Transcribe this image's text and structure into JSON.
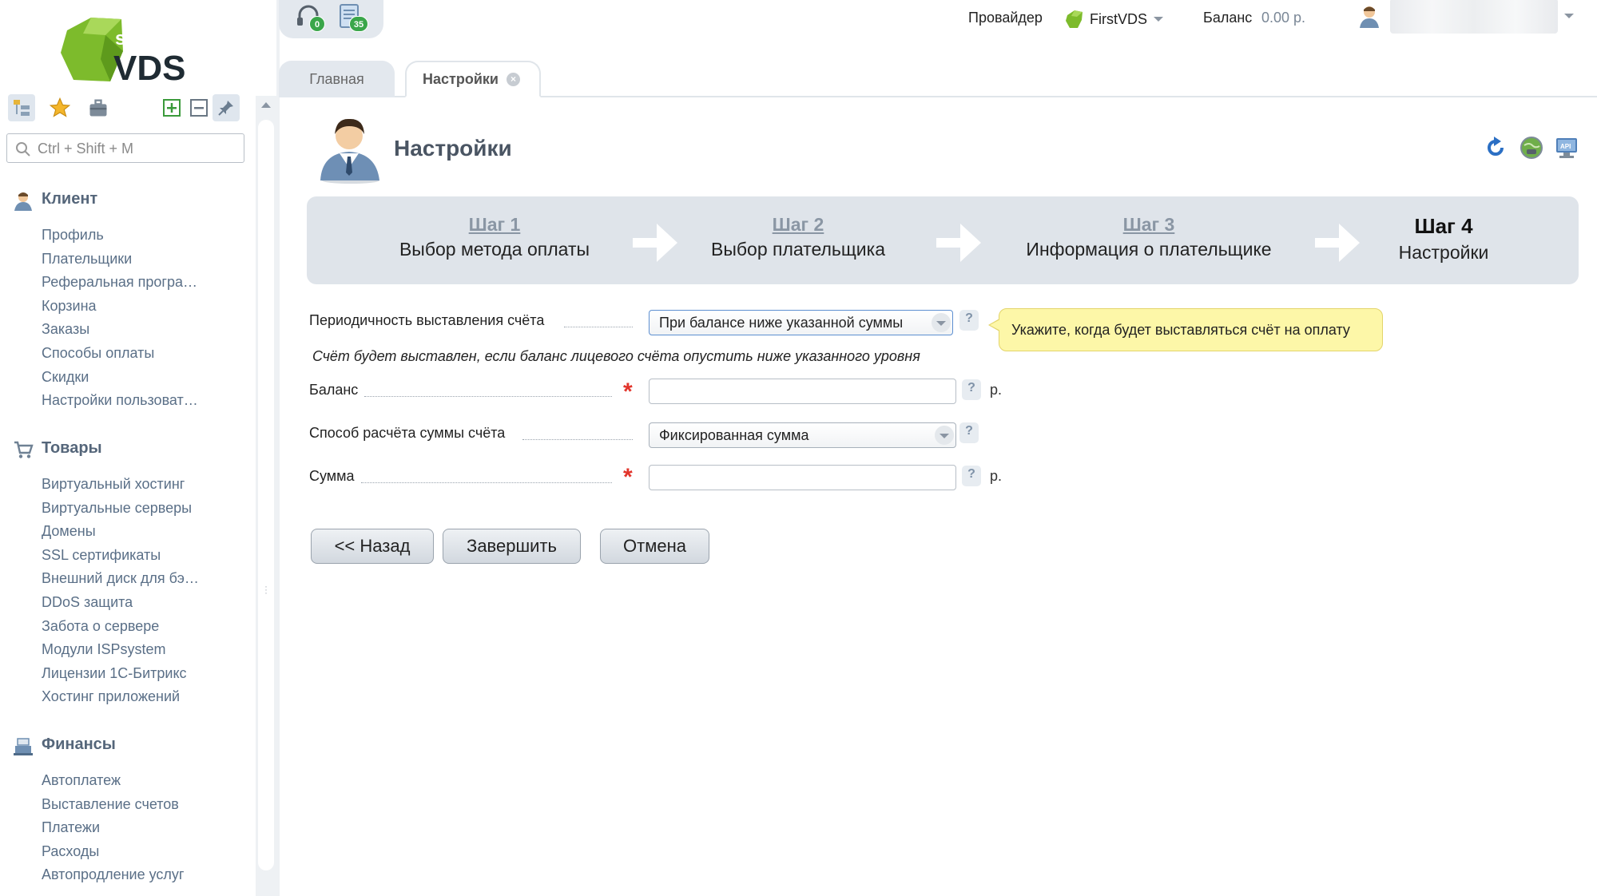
{
  "app": {
    "logo_text": "VDS",
    "logo_superscript": "st"
  },
  "sidebar": {
    "search_placeholder": "Ctrl + Shift + M",
    "groups": [
      {
        "title": "Клиент",
        "icon": "user-icon",
        "items": [
          "Профиль",
          "Плательщики",
          "Реферальная програ…",
          "Корзина",
          "Заказы",
          "Способы оплаты",
          "Скидки",
          "Настройки пользоват…"
        ]
      },
      {
        "title": "Товары",
        "icon": "cart-icon",
        "items": [
          "Виртуальный хостинг",
          "Виртуальные серверы",
          "Домены",
          "SSL сертификаты",
          "Внешний диск для бэ…",
          "DDoS защита",
          "Забота о сервере",
          "Модули ISPsystem",
          "Лицензии 1С-Битрикс",
          "Хостинг приложений"
        ]
      },
      {
        "title": "Финансы",
        "icon": "cash-register-icon",
        "items": [
          "Автоплатеж",
          "Выставление счетов",
          "Платежи",
          "Расходы",
          "Автопродление услуг"
        ]
      }
    ]
  },
  "top": {
    "support_badge": "0",
    "notifications_badge": "35",
    "provider_label": "Провайдер",
    "provider_name": "FirstVDS",
    "balance_label": "Баланс",
    "balance_value": "0.00 р."
  },
  "tabs": [
    {
      "label": "Главная",
      "active": false
    },
    {
      "label": "Настройки",
      "active": true
    }
  ],
  "page": {
    "title": "Настройки"
  },
  "steps": [
    {
      "number": "Шаг 1",
      "label": "Выбор метода оплаты"
    },
    {
      "number": "Шаг 2",
      "label": "Выбор плательщика"
    },
    {
      "number": "Шаг 3",
      "label": "Информация о плательщике"
    },
    {
      "number": "Шаг 4",
      "label": "Настройки"
    }
  ],
  "form": {
    "period_label": "Периодичность выставления счёта",
    "period_value": "При балансе ниже указанной суммы",
    "period_tooltip": "Укажите, когда будет выставляться счёт на оплату",
    "period_hint": "Счёт будет выставлен, если баланс лицевого счёта опустить ниже указанного уровня",
    "balance_label": "Баланс",
    "balance_value": "",
    "calc_label": "Способ расчёта суммы счёта",
    "calc_value": "Фиксированная сумма",
    "sum_label": "Сумма",
    "sum_value": "",
    "unit": "р.",
    "help_glyph": "?",
    "required_glyph": "*"
  },
  "buttons": {
    "back": "<< Назад",
    "finish": "Завершить",
    "cancel": "Отмена"
  },
  "colors": {
    "accent_green": "#7dbb2c",
    "link_blue": "#5a6f87",
    "tooltip_yellow": "#fdf7a8",
    "required_red": "#e2342b"
  }
}
